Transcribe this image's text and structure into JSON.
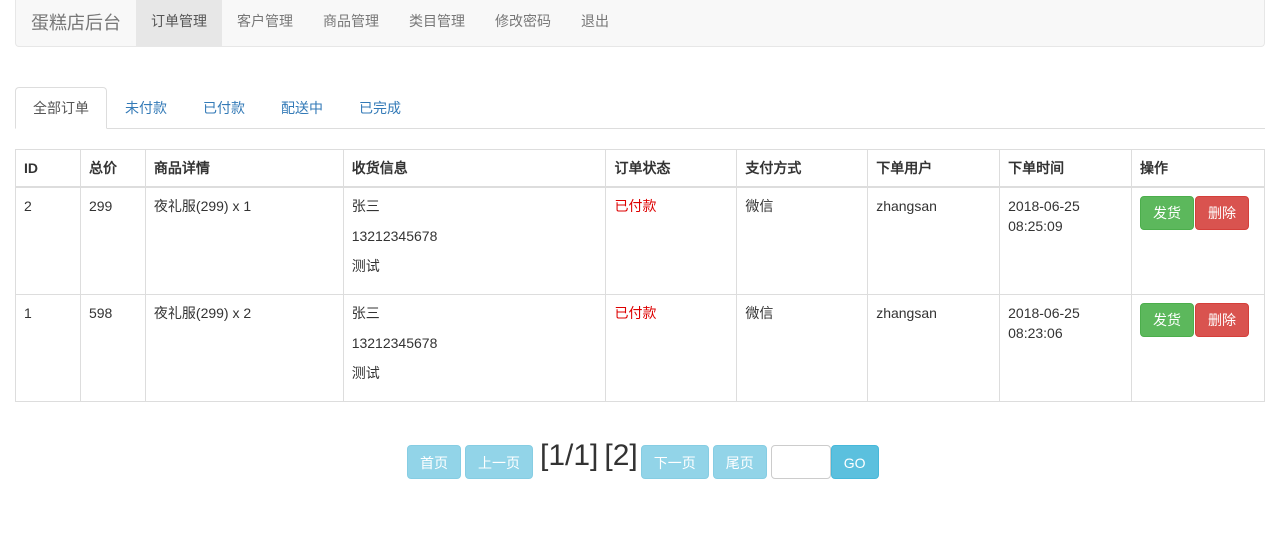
{
  "navbar": {
    "brand": "蛋糕店后台",
    "items": [
      {
        "label": "订单管理",
        "active": true
      },
      {
        "label": "客户管理"
      },
      {
        "label": "商品管理"
      },
      {
        "label": "类目管理"
      },
      {
        "label": "修改密码"
      },
      {
        "label": "退出"
      }
    ]
  },
  "tabs": [
    {
      "label": "全部订单",
      "active": true
    },
    {
      "label": "未付款"
    },
    {
      "label": "已付款"
    },
    {
      "label": "配送中"
    },
    {
      "label": "已完成"
    }
  ],
  "table": {
    "headers": [
      "ID",
      "总价",
      "商品详情",
      "收货信息",
      "订单状态",
      "支付方式",
      "下单用户",
      "下单时间",
      "操作"
    ],
    "rows": [
      {
        "id": "2",
        "total": "299",
        "detail": "夜礼服(299) x 1",
        "recv_name": "张三",
        "recv_phone": "13212345678",
        "recv_address": "测试",
        "status": "已付款",
        "payment": "微信",
        "user": "zhangsan",
        "date": "2018-06-25",
        "time": "08:25:09",
        "ship_label": "发货",
        "delete_label": "删除"
      },
      {
        "id": "1",
        "total": "598",
        "detail": "夜礼服(299) x 2",
        "recv_name": "张三",
        "recv_phone": "13212345678",
        "recv_address": "测试",
        "status": "已付款",
        "payment": "微信",
        "user": "zhangsan",
        "date": "2018-06-25",
        "time": "08:23:06",
        "ship_label": "发货",
        "delete_label": "删除"
      }
    ]
  },
  "pager": {
    "first": "首页",
    "prev": "上一页",
    "info": "[1/1]",
    "total": "[2]",
    "next": "下一页",
    "last": "尾页",
    "input_value": "",
    "go": "GO"
  },
  "colors": {
    "status_paid": "#dd0000",
    "ship_button": "#5cb85c",
    "delete_button": "#d9534f",
    "go_button": "#5bc0de"
  }
}
